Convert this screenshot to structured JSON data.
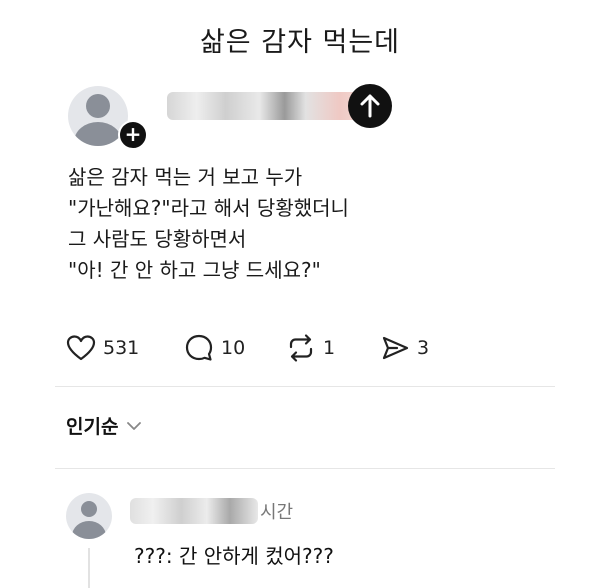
{
  "page": {
    "title": "삶은 감자 먹는데"
  },
  "post": {
    "lines": [
      "삶은 감자 먹는 거 보고 누가",
      "\"가난해요?\"라고 해서 당황했더니",
      "그 사람도 당황하면서",
      "\"아! 간 안 하고 그냥 드세요?\""
    ],
    "likes": "531",
    "replies": "10",
    "reposts": "1",
    "shares": "3"
  },
  "comments_section": {
    "sort_label": "인기순",
    "comment": {
      "time_suffix": "시간",
      "text": "???: 간 안하게 컸어???"
    }
  },
  "icons": {
    "follow_plus": "+",
    "up": "arrow-up-icon",
    "like": "heart-icon",
    "reply": "speech-bubble-icon",
    "repost": "repost-icon",
    "share": "send-icon",
    "sort": "chevron-down-icon"
  }
}
